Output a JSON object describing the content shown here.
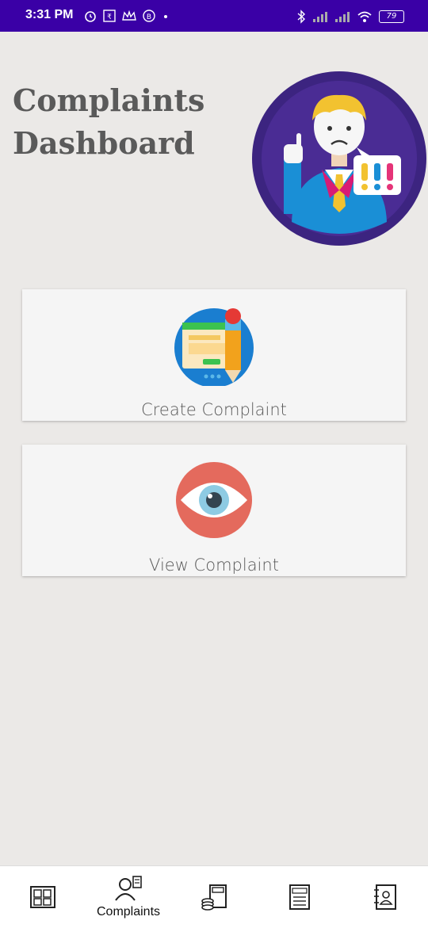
{
  "status_bar": {
    "time": "3:31 PM",
    "battery": "79",
    "icons": [
      "alarm-icon",
      "rs-icon",
      "crown-icon",
      "b-icon",
      "dot-icon",
      "bluetooth-icon",
      "signal-icon",
      "signal-icon",
      "wifi-icon",
      "battery-icon"
    ]
  },
  "header": {
    "title_line1": "Complaints",
    "title_line2": "Dashboard",
    "hero_icon": "complaining-man-icon"
  },
  "cards": [
    {
      "label": "Create Complaint",
      "icon": "form-pencil-icon"
    },
    {
      "label": "View Complaint",
      "icon": "eye-icon"
    }
  ],
  "bottom_nav": {
    "items": [
      {
        "label": "",
        "icon": "documents-icon"
      },
      {
        "label": "Complaints",
        "icon": "person-complaint-icon"
      },
      {
        "label": "",
        "icon": "calculator-coins-icon"
      },
      {
        "label": "",
        "icon": "rules-book-icon"
      },
      {
        "label": "",
        "icon": "contacts-book-icon"
      }
    ]
  },
  "colors": {
    "status_bar": "#3a00a6",
    "background": "#ebe9e7",
    "card": "#f5f5f5",
    "title_text": "#5a5a5a",
    "hero_circle": "#3c2480"
  }
}
